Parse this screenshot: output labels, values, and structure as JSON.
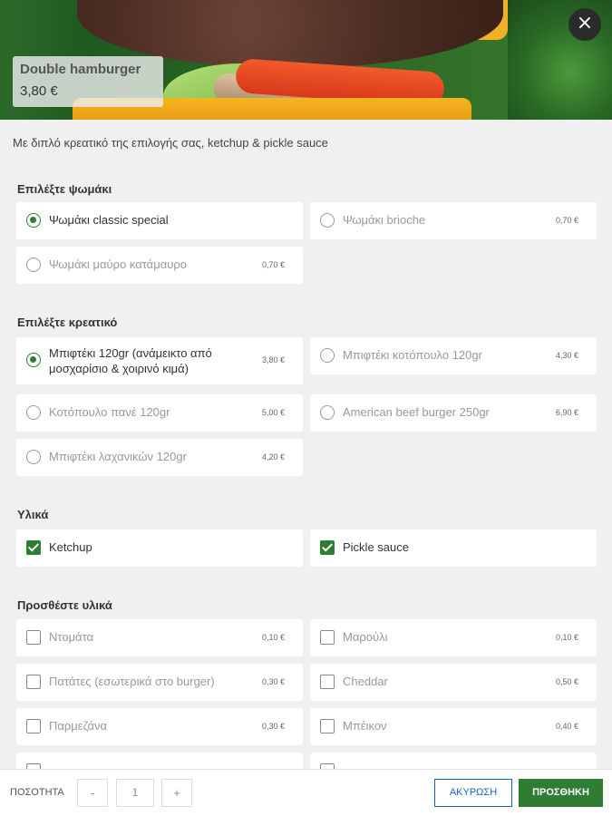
{
  "product": {
    "name": "Double hamburger",
    "price": "3,80 €",
    "description": "Με διπλό κρεατικό της επιλογής σας, ketchup & pickle sauce"
  },
  "close_icon": "close-icon",
  "sections": {
    "bread": {
      "title": "Επιλέξτε ψωμάκι",
      "options": [
        {
          "label": "Ψωμάκι classic special",
          "price": "",
          "selected": true
        },
        {
          "label": "Ψωμάκι brioche",
          "price": "0,70 €",
          "selected": false
        },
        {
          "label": "Ψωμάκι μαύρο κατάμαυρο",
          "price": "0,70 €",
          "selected": false
        }
      ]
    },
    "meat": {
      "title": "Επιλέξτε κρεατικό",
      "options": [
        {
          "label": "Μπιφτέκι 120gr (ανάμεικτο από μοσχαρίσιο & χοιρινό κιμά)",
          "price": "3,80 €",
          "selected": true
        },
        {
          "label": "Μπιφτέκι κοτόπουλο 120gr",
          "price": "4,30 €",
          "selected": false
        },
        {
          "label": "Κοτόπουλο πανέ 120gr",
          "price": "5,00 €",
          "selected": false
        },
        {
          "label": "American beef burger 250gr",
          "price": "6,90 €",
          "selected": false
        },
        {
          "label": "Μπιφτέκι λαχανικών 120gr",
          "price": "4,20 €",
          "selected": false
        }
      ]
    },
    "ingredients": {
      "title": "Υλικά",
      "options": [
        {
          "label": "Ketchup",
          "checked": true
        },
        {
          "label": "Pickle sauce",
          "checked": true
        }
      ]
    },
    "extras": {
      "title": "Προσθέστε υλικά",
      "options": [
        {
          "label": "Ντομάτα",
          "price": "0,10 €",
          "checked": false
        },
        {
          "label": "Μαρούλι",
          "price": "0,10 €",
          "checked": false
        },
        {
          "label": "Πατάτες (εσωτερικά στο burger)",
          "price": "0,30 €",
          "checked": false
        },
        {
          "label": "Cheddar",
          "price": "0,50 €",
          "checked": false
        },
        {
          "label": "Παρμεζάνα",
          "price": "0,30 €",
          "checked": false
        },
        {
          "label": "Μπέικον",
          "price": "0,40 €",
          "checked": false
        }
      ]
    }
  },
  "footer": {
    "quantity_label": "ΠΟΣΟΤΗΤΑ",
    "minus": "-",
    "quantity": "1",
    "plus": "+",
    "cancel": "ΑΚΥΡΩΣΗ",
    "add": "ΠΡΟΣΘΗΚΗ"
  }
}
